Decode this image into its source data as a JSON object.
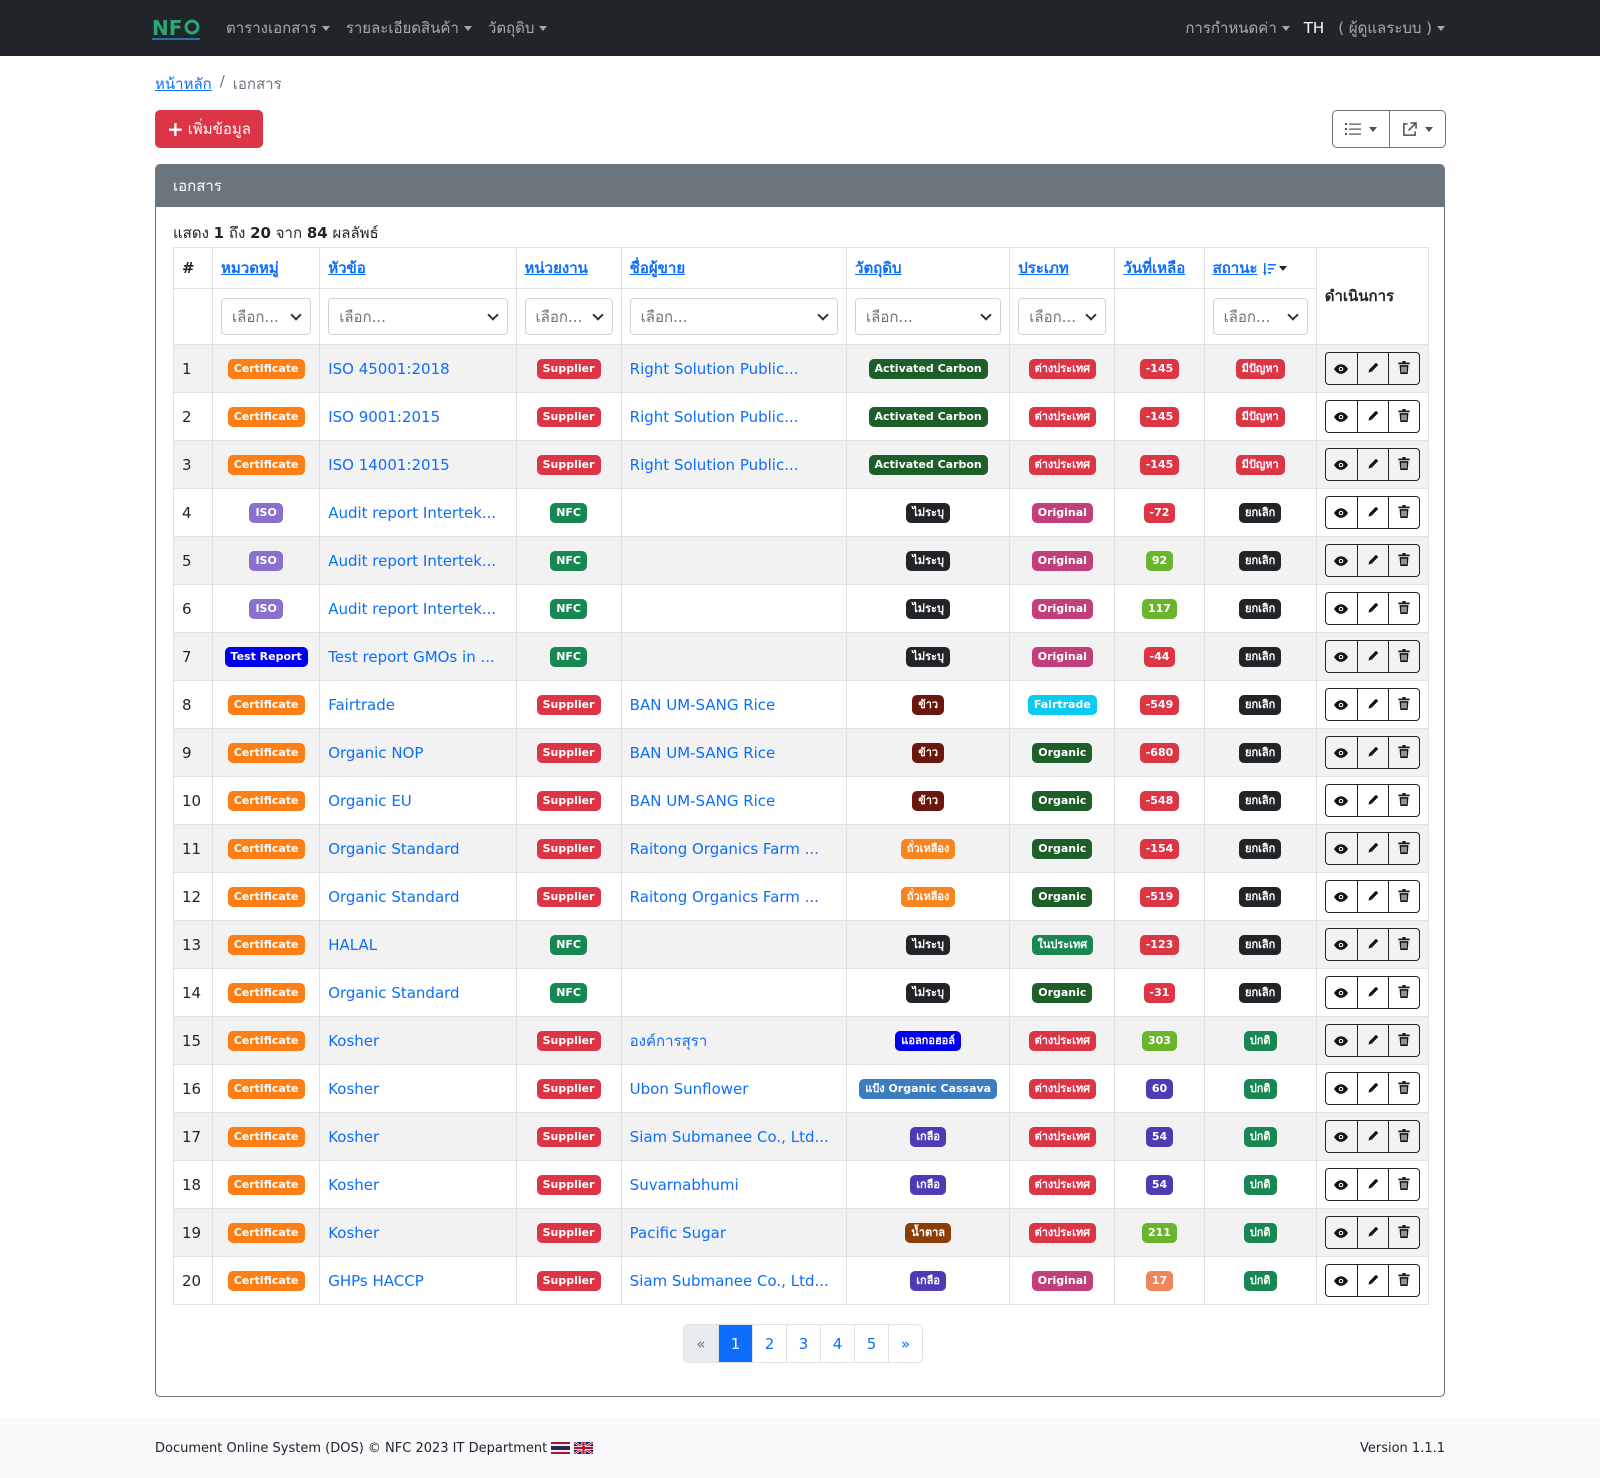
{
  "nav": {
    "brand": "NFC",
    "menu": [
      "ตารางเอกสาร",
      "รายละเอียดสินค้า",
      "วัตถุดิบ"
    ],
    "settings": "การกำหนดค่า",
    "lang": "TH",
    "user": "( ผู้ดูแลระบบ )"
  },
  "breadcrumb": {
    "home": "หน้าหลัก",
    "sep": "/",
    "current": "เอกสาร"
  },
  "add_button": "เพิ่มข้อมูล",
  "card_title": "เอกสาร",
  "summary": {
    "prefix": "แสดง",
    "from": "1",
    "to_label": "ถึง",
    "to": "20",
    "of_label": "จาก",
    "total": "84",
    "suffix": "ผลลัพธ์"
  },
  "columns": {
    "idx": "#",
    "category": "หมวดหมู่",
    "title": "หัวข้อ",
    "unit": "หน่วยงาน",
    "seller": "ชื่อผู้ขาย",
    "material": "วัตถุดิบ",
    "type": "ประเภท",
    "days": "วันที่เหลือ",
    "status": "สถานะ",
    "action": "ดำเนินการ"
  },
  "filters": {
    "category": "เลือก...",
    "title": "เลือก...",
    "unit": "เลือก...",
    "seller": "เลือก...",
    "material": "เลือก...",
    "type": "เลือก...",
    "status": "เลือก..."
  },
  "colors": {
    "orange": "#fd7e14",
    "purple": "#8a6fcf",
    "blue": "#0000ee",
    "red": "#dc3545",
    "green": "#198754",
    "darkgreen": "#1d5e2a",
    "black": "#212529",
    "maroon": "#6b1710",
    "pink": "#c2407a",
    "sky": "#0dcaf0",
    "amber": "#f7841c",
    "indigo": "#4e3bb4",
    "steel": "#3b7dbf",
    "brown": "#8b3e07",
    "lime": "#6bb52e",
    "salmon": "#f0845b"
  },
  "rows": [
    {
      "n": "1",
      "cat": "Certificate",
      "catc": "orange",
      "title": "ISO 45001:2018",
      "unit": "Supplier",
      "unitc": "red",
      "seller": "Right Solution Public...",
      "mat": "Activated Carbon",
      "matc": "darkgreen",
      "type": "ต่างประเทศ",
      "typec": "red",
      "days": "-145",
      "daysc": "red",
      "status": "มีปัญหา",
      "statusc": "red"
    },
    {
      "n": "2",
      "cat": "Certificate",
      "catc": "orange",
      "title": "ISO 9001:2015",
      "unit": "Supplier",
      "unitc": "red",
      "seller": "Right Solution Public...",
      "mat": "Activated Carbon",
      "matc": "darkgreen",
      "type": "ต่างประเทศ",
      "typec": "red",
      "days": "-145",
      "daysc": "red",
      "status": "มีปัญหา",
      "statusc": "red"
    },
    {
      "n": "3",
      "cat": "Certificate",
      "catc": "orange",
      "title": "ISO 14001:2015",
      "unit": "Supplier",
      "unitc": "red",
      "seller": "Right Solution Public...",
      "mat": "Activated Carbon",
      "matc": "darkgreen",
      "type": "ต่างประเทศ",
      "typec": "red",
      "days": "-145",
      "daysc": "red",
      "status": "มีปัญหา",
      "statusc": "red"
    },
    {
      "n": "4",
      "cat": "ISO",
      "catc": "purple",
      "title": "Audit report Intertek...",
      "unit": "NFC",
      "unitc": "green",
      "seller": "",
      "mat": "ไม่ระบุ",
      "matc": "black",
      "type": "Original",
      "typec": "pink",
      "days": "-72",
      "daysc": "red",
      "status": "ยกเลิก",
      "statusc": "black"
    },
    {
      "n": "5",
      "cat": "ISO",
      "catc": "purple",
      "title": "Audit report Intertek...",
      "unit": "NFC",
      "unitc": "green",
      "seller": "",
      "mat": "ไม่ระบุ",
      "matc": "black",
      "type": "Original",
      "typec": "pink",
      "days": "92",
      "daysc": "lime",
      "status": "ยกเลิก",
      "statusc": "black"
    },
    {
      "n": "6",
      "cat": "ISO",
      "catc": "purple",
      "title": "Audit report Intertek...",
      "unit": "NFC",
      "unitc": "green",
      "seller": "",
      "mat": "ไม่ระบุ",
      "matc": "black",
      "type": "Original",
      "typec": "pink",
      "days": "117",
      "daysc": "lime",
      "status": "ยกเลิก",
      "statusc": "black"
    },
    {
      "n": "7",
      "cat": "Test Report",
      "catc": "blue",
      "title": "Test report GMOs in ...",
      "unit": "NFC",
      "unitc": "green",
      "seller": "",
      "mat": "ไม่ระบุ",
      "matc": "black",
      "type": "Original",
      "typec": "pink",
      "days": "-44",
      "daysc": "red",
      "status": "ยกเลิก",
      "statusc": "black"
    },
    {
      "n": "8",
      "cat": "Certificate",
      "catc": "orange",
      "title": "Fairtrade",
      "unit": "Supplier",
      "unitc": "red",
      "seller": "BAN UM-SANG Rice",
      "mat": "ข้าว",
      "matc": "maroon",
      "type": "Fairtrade",
      "typec": "sky",
      "days": "-549",
      "daysc": "red",
      "status": "ยกเลิก",
      "statusc": "black"
    },
    {
      "n": "9",
      "cat": "Certificate",
      "catc": "orange",
      "title": "Organic NOP",
      "unit": "Supplier",
      "unitc": "red",
      "seller": "BAN UM-SANG Rice",
      "mat": "ข้าว",
      "matc": "maroon",
      "type": "Organic",
      "typec": "darkgreen",
      "days": "-680",
      "daysc": "red",
      "status": "ยกเลิก",
      "statusc": "black"
    },
    {
      "n": "10",
      "cat": "Certificate",
      "catc": "orange",
      "title": "Organic EU",
      "unit": "Supplier",
      "unitc": "red",
      "seller": "BAN UM-SANG Rice",
      "mat": "ข้าว",
      "matc": "maroon",
      "type": "Organic",
      "typec": "darkgreen",
      "days": "-548",
      "daysc": "red",
      "status": "ยกเลิก",
      "statusc": "black"
    },
    {
      "n": "11",
      "cat": "Certificate",
      "catc": "orange",
      "title": "Organic Standard",
      "unit": "Supplier",
      "unitc": "red",
      "seller": "Raitong Organics Farm ...",
      "mat": "ถั่วเหลือง",
      "matc": "amber",
      "type": "Organic",
      "typec": "darkgreen",
      "days": "-154",
      "daysc": "red",
      "status": "ยกเลิก",
      "statusc": "black"
    },
    {
      "n": "12",
      "cat": "Certificate",
      "catc": "orange",
      "title": "Organic Standard",
      "unit": "Supplier",
      "unitc": "red",
      "seller": "Raitong Organics Farm ...",
      "mat": "ถั่วเหลือง",
      "matc": "amber",
      "type": "Organic",
      "typec": "darkgreen",
      "days": "-519",
      "daysc": "red",
      "status": "ยกเลิก",
      "statusc": "black"
    },
    {
      "n": "13",
      "cat": "Certificate",
      "catc": "orange",
      "title": "HALAL",
      "unit": "NFC",
      "unitc": "green",
      "seller": "",
      "mat": "ไม่ระบุ",
      "matc": "black",
      "type": "ในประเทศ",
      "typec": "green",
      "days": "-123",
      "daysc": "red",
      "status": "ยกเลิก",
      "statusc": "black"
    },
    {
      "n": "14",
      "cat": "Certificate",
      "catc": "orange",
      "title": "Organic Standard",
      "unit": "NFC",
      "unitc": "green",
      "seller": "",
      "mat": "ไม่ระบุ",
      "matc": "black",
      "type": "Organic",
      "typec": "darkgreen",
      "days": "-31",
      "daysc": "red",
      "status": "ยกเลิก",
      "statusc": "black"
    },
    {
      "n": "15",
      "cat": "Certificate",
      "catc": "orange",
      "title": "Kosher",
      "unit": "Supplier",
      "unitc": "red",
      "seller": "องค์การสุรา",
      "mat": "แอลกอฮอล์",
      "matc": "blue",
      "type": "ต่างประเทศ",
      "typec": "red",
      "days": "303",
      "daysc": "lime",
      "status": "ปกติ",
      "statusc": "green"
    },
    {
      "n": "16",
      "cat": "Certificate",
      "catc": "orange",
      "title": "Kosher",
      "unit": "Supplier",
      "unitc": "red",
      "seller": "Ubon Sunflower",
      "mat": "แป้ง Organic Cassava",
      "matc": "steel",
      "type": "ต่างประเทศ",
      "typec": "red",
      "days": "60",
      "daysc": "indigo",
      "status": "ปกติ",
      "statusc": "green"
    },
    {
      "n": "17",
      "cat": "Certificate",
      "catc": "orange",
      "title": "Kosher",
      "unit": "Supplier",
      "unitc": "red",
      "seller": "Siam Submanee Co., Ltd...",
      "mat": "เกลือ",
      "matc": "indigo",
      "type": "ต่างประเทศ",
      "typec": "red",
      "days": "54",
      "daysc": "indigo",
      "status": "ปกติ",
      "statusc": "green"
    },
    {
      "n": "18",
      "cat": "Certificate",
      "catc": "orange",
      "title": "Kosher",
      "unit": "Supplier",
      "unitc": "red",
      "seller": "Suvarnabhumi",
      "mat": "เกลือ",
      "matc": "indigo",
      "type": "ต่างประเทศ",
      "typec": "red",
      "days": "54",
      "daysc": "indigo",
      "status": "ปกติ",
      "statusc": "green"
    },
    {
      "n": "19",
      "cat": "Certificate",
      "catc": "orange",
      "title": "Kosher",
      "unit": "Supplier",
      "unitc": "red",
      "seller": "Pacific Sugar",
      "mat": "น้ำตาล",
      "matc": "brown",
      "type": "ต่างประเทศ",
      "typec": "red",
      "days": "211",
      "daysc": "lime",
      "status": "ปกติ",
      "statusc": "green"
    },
    {
      "n": "20",
      "cat": "Certificate",
      "catc": "orange",
      "title": "GHPs HACCP",
      "unit": "Supplier",
      "unitc": "red",
      "seller": "Siam Submanee Co., Ltd...",
      "mat": "เกลือ",
      "matc": "indigo",
      "type": "Original",
      "typec": "pink",
      "days": "17",
      "daysc": "salmon",
      "status": "ปกติ",
      "statusc": "green"
    }
  ],
  "pagination": [
    "«",
    "1",
    "2",
    "3",
    "4",
    "5",
    "»"
  ],
  "pagination_active": "1",
  "footer": {
    "text": "Document Online System (DOS) © NFC 2023  IT Department",
    "version": "Version 1.1.1"
  }
}
